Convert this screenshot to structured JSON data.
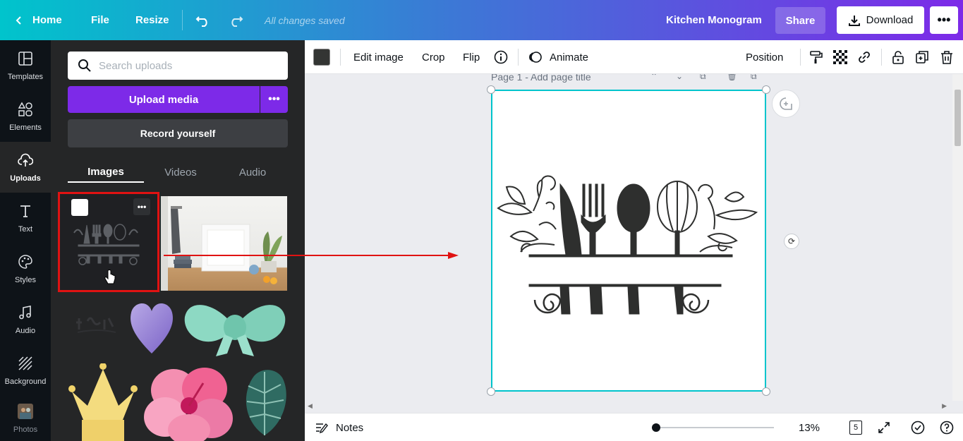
{
  "header": {
    "home": "Home",
    "file": "File",
    "resize": "Resize",
    "saved_status": "All changes saved",
    "doc_title": "Kitchen Monogram",
    "share": "Share",
    "download": "Download"
  },
  "rail": {
    "items": [
      {
        "label": "Templates",
        "icon": "templates-icon"
      },
      {
        "label": "Elements",
        "icon": "elements-icon"
      },
      {
        "label": "Uploads",
        "icon": "cloud-upload-icon",
        "active": true
      },
      {
        "label": "Text",
        "icon": "text-icon"
      },
      {
        "label": "Styles",
        "icon": "palette-icon"
      },
      {
        "label": "Audio",
        "icon": "music-note-icon"
      },
      {
        "label": "Background",
        "icon": "background-hatch-icon"
      },
      {
        "label": "Photos",
        "icon": "photos-icon"
      }
    ]
  },
  "panel": {
    "search_placeholder": "Search uploads",
    "upload_media": "Upload media",
    "record_yourself": "Record yourself",
    "tabs": [
      "Images",
      "Videos",
      "Audio"
    ],
    "active_tab": "Images"
  },
  "toolbar": {
    "edit_image": "Edit image",
    "crop": "Crop",
    "flip": "Flip",
    "animate": "Animate",
    "position": "Position",
    "color_swatch": "#333533"
  },
  "canvas": {
    "page_label": "Page 1 - Add page title"
  },
  "bottombar": {
    "notes": "Notes",
    "zoom": "13%",
    "zoom_fraction": 0.0,
    "page_count": "5"
  },
  "colors": {
    "brand_purple": "#7d2ae8",
    "brand_teal": "#00c4cc",
    "highlight_red": "#e01212"
  }
}
